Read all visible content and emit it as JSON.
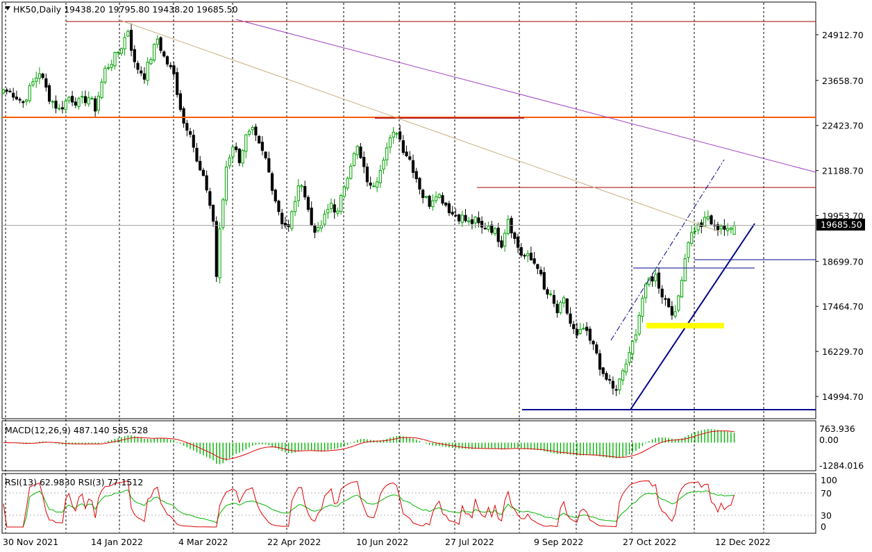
{
  "header": {
    "symbol_line": "HK50,Daily  19438.20 19795.80 19438.20 19685.50",
    "macd_label": "MACD(12,26,9) 487.140 585.528",
    "rsi_label": "RSI(13) 62.9830  RSI(3) 77.1512"
  },
  "colors": {
    "background": "#ffffff",
    "up_candle": "#00a000",
    "down_candle": "#000000",
    "resistance_orange": "#ff5a00",
    "resistance_dark": "#a00000",
    "trend_tan": "#c8b080",
    "trend_purple": "#a040c0",
    "channel_blue": "#00008c",
    "support_zone": "#ffff00",
    "macd_hist": "#00b400",
    "macd_signal": "#dd0000",
    "rsi_fast": "#dd0000",
    "rsi_slow": "#00b400",
    "current_price_line": "#a0a0a0"
  },
  "chart_data": [
    {
      "type": "candlestick",
      "title": "HK50,Daily",
      "ohlc_last": {
        "open": 19438.2,
        "high": 19795.8,
        "low": 19438.2,
        "close": 19685.5
      },
      "current_price": 19685.5,
      "y_ticks": [
        24912.7,
        23658.7,
        22423.7,
        21188.7,
        19953.7,
        18699.7,
        17464.7,
        16229.7,
        14994.7
      ],
      "y_tick_labels": [
        "24912.70",
        "23658.70",
        "22423.70",
        "21188.70",
        "19953.70",
        "18699.70",
        "17464.70",
        "16229.70",
        "14994.70"
      ],
      "current_price_label": "19685.50",
      "ylim": [
        14740,
        25750
      ],
      "x_tick_labels": [
        "30 Nov 2021",
        "14 Jan 2022",
        "4 Mar 2022",
        "22 Apr 2022",
        "10 Jun 2022",
        "27 Jul 2022",
        "9 Sep 2022",
        "27 Oct 2022",
        "12 Dec 2022"
      ],
      "grid": "vertical-dashed",
      "close_path": [
        [
          0,
          23400
        ],
        [
          3,
          23300
        ],
        [
          6,
          23050
        ],
        [
          9,
          23600
        ],
        [
          11,
          23900
        ],
        [
          14,
          23200
        ],
        [
          17,
          22850
        ],
        [
          20,
          23200
        ],
        [
          23,
          23050
        ],
        [
          26,
          23200
        ],
        [
          28,
          22900
        ],
        [
          31,
          23950
        ],
        [
          34,
          24300
        ],
        [
          36,
          24600
        ],
        [
          38,
          25050
        ],
        [
          40,
          24100
        ],
        [
          43,
          23800
        ],
        [
          45,
          24300
        ],
        [
          47,
          24800
        ],
        [
          49,
          24300
        ],
        [
          52,
          23800
        ],
        [
          55,
          22500
        ],
        [
          57,
          22300
        ],
        [
          59,
          21400
        ],
        [
          62,
          20700
        ],
        [
          64,
          19800
        ],
        [
          65,
          18300
        ],
        [
          66,
          19500
        ],
        [
          68,
          21300
        ],
        [
          70,
          21900
        ],
        [
          72,
          21500
        ],
        [
          74,
          22100
        ],
        [
          76,
          22250
        ],
        [
          78,
          21850
        ],
        [
          80,
          21500
        ],
        [
          83,
          20400
        ],
        [
          85,
          19800
        ],
        [
          87,
          19600
        ],
        [
          89,
          20400
        ],
        [
          91,
          20900
        ],
        [
          94,
          19700
        ],
        [
          96,
          19500
        ],
        [
          98,
          19900
        ],
        [
          100,
          20300
        ],
        [
          102,
          20000
        ],
        [
          104,
          20800
        ],
        [
          106,
          21400
        ],
        [
          108,
          21800
        ],
        [
          110,
          21200
        ],
        [
          112,
          20700
        ],
        [
          114,
          21000
        ],
        [
          116,
          21600
        ],
        [
          118,
          22000
        ],
        [
          120,
          22300
        ],
        [
          122,
          21800
        ],
        [
          124,
          21500
        ],
        [
          126,
          21000
        ],
        [
          128,
          20500
        ],
        [
          130,
          20300
        ],
        [
          132,
          20600
        ],
        [
          134,
          20400
        ],
        [
          137,
          20000
        ],
        [
          140,
          19900
        ],
        [
          142,
          19750
        ],
        [
          144,
          19800
        ],
        [
          146,
          19600
        ],
        [
          148,
          19700
        ],
        [
          150,
          19500
        ],
        [
          152,
          19200
        ],
        [
          154,
          19900
        ],
        [
          156,
          19300
        ],
        [
          158,
          18900
        ],
        [
          160,
          18800
        ],
        [
          163,
          18600
        ],
        [
          165,
          17900
        ],
        [
          167,
          17700
        ],
        [
          169,
          17300
        ],
        [
          171,
          17600
        ],
        [
          173,
          17000
        ],
        [
          175,
          16600
        ],
        [
          177,
          16850
        ],
        [
          179,
          16500
        ],
        [
          181,
          16200
        ],
        [
          183,
          15500
        ],
        [
          185,
          15400
        ],
        [
          187,
          15100
        ],
        [
          189,
          15700
        ],
        [
          191,
          16100
        ],
        [
          193,
          16800
        ],
        [
          195,
          17700
        ],
        [
          197,
          18200
        ],
        [
          199,
          18300
        ],
        [
          201,
          17800
        ],
        [
          203,
          17500
        ],
        [
          205,
          17200
        ],
        [
          207,
          18300
        ],
        [
          209,
          19300
        ],
        [
          211,
          19600
        ],
        [
          213,
          19700
        ],
        [
          215,
          19900
        ],
        [
          217,
          19600
        ],
        [
          219,
          19700
        ],
        [
          221,
          19500
        ],
        [
          223,
          19685.5
        ]
      ]
    },
    {
      "type": "macd",
      "title": "MACD(12,26,9)",
      "macd": 487.14,
      "signal": 585.528,
      "y_tick_labels": [
        "763.936",
        "0.00",
        "-1284.016"
      ],
      "ylim": [
        -1284.016,
        763.936
      ]
    },
    {
      "type": "rsi",
      "title": "RSI(13)",
      "rsi13": 62.983,
      "rsi3": 77.1512,
      "y_ticks": [
        100,
        70,
        30,
        0
      ],
      "y_tick_labels": [
        "100",
        "70",
        "30",
        "0"
      ],
      "levels": [
        70,
        30
      ],
      "ylim": [
        0,
        100
      ]
    }
  ]
}
